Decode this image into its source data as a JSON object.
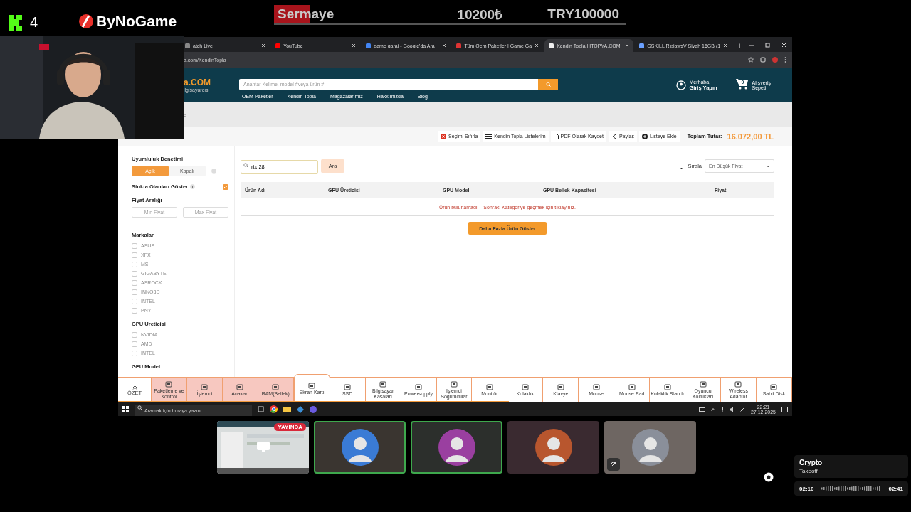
{
  "overlay": {
    "viewer_count": "4",
    "brand": "ByNoGame",
    "budget": {
      "label": "Sermaye",
      "spent": "10200₺",
      "total": "TRY100000",
      "level": 0.102
    }
  },
  "browser": {
    "tabs": [
      {
        "title": "atch Live",
        "selected": false
      },
      {
        "title": "YouTube",
        "selected": false
      },
      {
        "title": "game garaj - Google'da Ara",
        "selected": false
      },
      {
        "title": "Tüm Oem Paketler | Game Ga",
        "selected": false
      },
      {
        "title": "Kendin Topla | ITOPYA.COM",
        "selected": true
      },
      {
        "title": "GSKILL RipjawsV Siyah 16GB (1",
        "selected": false
      }
    ],
    "new_tab": "+",
    "url": "a.com/KendinTopla"
  },
  "site": {
    "logo": "a.COM",
    "logo_sub": "ilgisayarcısı",
    "search_placeholder": "Anahtar Kelime, model #veya ürün #",
    "nav": [
      "OEM Paketler",
      "Kendin Topla",
      "Mağazalarımız",
      "Hakkımızda",
      "Blog"
    ],
    "account": {
      "greeting": "Merhaba,",
      "action": "Giriş Yapın"
    },
    "cart": {
      "count": "0",
      "line1": "Alışveriş",
      "line2": "Sepeti"
    },
    "breadcrumb": "e",
    "actions": [
      {
        "label": "Seçimi Sıfırla",
        "kind": "reset"
      },
      {
        "label": "Kendin Topla Listelerim",
        "kind": "list"
      },
      {
        "label": "PDF Olarak Kaydet",
        "kind": "pdf"
      },
      {
        "label": "Paylaş",
        "kind": "share"
      },
      {
        "label": "Listeye Ekle",
        "kind": "add"
      }
    ],
    "total_label": "Toplam Tutar:",
    "total": "16.072,00 TL"
  },
  "sidebar": {
    "compat_title": "Uyumluluk Denetimi",
    "compat_options": [
      {
        "label": "Açık",
        "selected": true
      },
      {
        "label": "Kapalı",
        "selected": false
      }
    ],
    "stock_label": "Stokta Olanları Göster",
    "stock_checked": true,
    "price_title": "Fiyat Aralığı",
    "price_min_placeholder": "Min Fiyat",
    "price_max_placeholder": "Max Fiyat",
    "groups": [
      {
        "title": "Markalar",
        "items": [
          {
            "label": "ASUS",
            "checked": false
          },
          {
            "label": "XFX",
            "checked": false
          },
          {
            "label": "MSI",
            "checked": false
          },
          {
            "label": "GIGABYTE",
            "checked": false
          },
          {
            "label": "ASROCK",
            "checked": false
          },
          {
            "label": "INNO3D",
            "checked": false
          },
          {
            "label": "INTEL",
            "checked": false
          },
          {
            "label": "PNY",
            "checked": false
          }
        ]
      },
      {
        "title": "GPU Üreticisi",
        "items": [
          {
            "label": "NVIDIA",
            "checked": false
          },
          {
            "label": "AMD",
            "checked": false
          },
          {
            "label": "INTEL",
            "checked": false
          }
        ]
      },
      {
        "title": "GPU Model"
      }
    ]
  },
  "main": {
    "search_value": "rtx 28",
    "search_button": "Ara",
    "sort_label": "Sırala",
    "sort_value": "En Düşük Fiyat",
    "columns": [
      "Ürün Adı",
      "GPU Üreticisi",
      "GPU Model",
      "GPU Bellek Kapasitesi",
      "Fiyat"
    ],
    "empty_message": "Ürün bulunamadı -- Sonraki Kategoriye geçmek için tıklayınız.",
    "more_button": "Daha Fazla Ürün Göster"
  },
  "categories": {
    "summary": "ÖZET",
    "progress": {
      "level": 0.58
    },
    "items": [
      {
        "label": "Paketleme ve Kontrol",
        "selected": false,
        "completed": true
      },
      {
        "label": "İşlemci",
        "selected": false,
        "completed": true
      },
      {
        "label": "Anakart",
        "selected": false,
        "completed": true
      },
      {
        "label": "RAM(Bellek)",
        "selected": false,
        "completed": true
      },
      {
        "label": "Ekran Kartı",
        "selected": true,
        "completed": false
      },
      {
        "label": "SSD",
        "selected": false,
        "completed": false
      },
      {
        "label": "Bilgisayar Kasaları",
        "selected": false,
        "completed": false
      },
      {
        "label": "Powersupply",
        "selected": false,
        "completed": false
      },
      {
        "label": "İşlemci Soğutucular",
        "selected": false,
        "completed": false
      },
      {
        "label": "Monitör",
        "selected": false,
        "completed": false
      },
      {
        "label": "Kulaklık",
        "selected": false,
        "completed": false
      },
      {
        "label": "Klavye",
        "selected": false,
        "completed": false
      },
      {
        "label": "Mouse",
        "selected": false,
        "completed": false
      },
      {
        "label": "Mouse Pad",
        "selected": false,
        "completed": false
      },
      {
        "label": "Kulaklık Standı",
        "selected": false,
        "completed": false
      },
      {
        "label": "Oyuncu Koltukları",
        "selected": false,
        "completed": false
      },
      {
        "label": "Wireless Adaptör",
        "selected": false,
        "completed": false
      },
      {
        "label": "Sabit Disk",
        "selected": false,
        "completed": false
      }
    ]
  },
  "taskbar": {
    "search_placeholder": "Aramak için buraya yazın",
    "time": "22:21",
    "date": "27.12.2025"
  },
  "participants": [
    {
      "kind": "screen",
      "badge": "YAYINDA",
      "speaking": false
    },
    {
      "kind": "avatar",
      "speaking": true,
      "muted": false,
      "color": "#3a7bd5"
    },
    {
      "kind": "avatar",
      "speaking": true,
      "muted": false,
      "color": "#9a3fa0"
    },
    {
      "kind": "avatar",
      "speaking": false,
      "muted": false,
      "color": "#b8562e"
    },
    {
      "kind": "avatar",
      "speaking": false,
      "muted": true,
      "color": "#8a8f9a"
    }
  ],
  "music": {
    "title": "Crypto",
    "artist": "Takeoff",
    "elapsed": "02:10",
    "duration": "02:41"
  }
}
